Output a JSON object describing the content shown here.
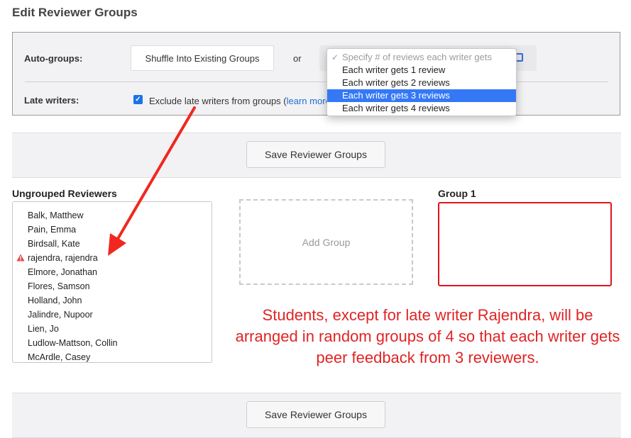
{
  "page": {
    "title": "Edit Reviewer Groups"
  },
  "settings": {
    "auto_groups_label": "Auto-groups:",
    "shuffle_button": "Shuffle Into Existing Groups",
    "or_text": "or",
    "late_writers_label": "Late writers:",
    "exclude_late": {
      "checked": true,
      "text": "Exclude late writers from groups (",
      "link": "learn more"
    }
  },
  "dropdown": {
    "placeholder": "Specify # of reviews each writer gets",
    "options": [
      "Each writer gets 1 review",
      "Each writer gets 2 reviews",
      "Each writer gets 3 reviews",
      "Each writer gets 4 reviews"
    ],
    "selected_index": 2
  },
  "save_button_label": "Save Reviewer Groups",
  "ungrouped": {
    "heading": "Ungrouped Reviewers",
    "reviewers": [
      {
        "name": "Balk, Matthew",
        "late": false
      },
      {
        "name": "Pain, Emma",
        "late": false
      },
      {
        "name": "Birdsall, Kate",
        "late": false
      },
      {
        "name": "rajendra, rajendra",
        "late": true
      },
      {
        "name": "Elmore, Jonathan",
        "late": false
      },
      {
        "name": "Flores, Samson",
        "late": false
      },
      {
        "name": "Holland, John",
        "late": false
      },
      {
        "name": "Jalindre, Nupoor",
        "late": false
      },
      {
        "name": "Lien, Jo",
        "late": false
      },
      {
        "name": "Ludlow-Mattson, Collin",
        "late": false
      },
      {
        "name": "McArdle, Casey",
        "late": false
      }
    ]
  },
  "add_group_label": "Add Group",
  "group1": {
    "heading": "Group 1"
  },
  "annotation": "Students, except for late writer Rajendra, will be arranged in random groups of 4 so that each writer gets peer feedback from 3 reviewers.",
  "colors": {
    "accent": "#3478f6",
    "annotation_red": "#e02424",
    "warning": "#e4474a",
    "link": "#1a6fd1"
  }
}
